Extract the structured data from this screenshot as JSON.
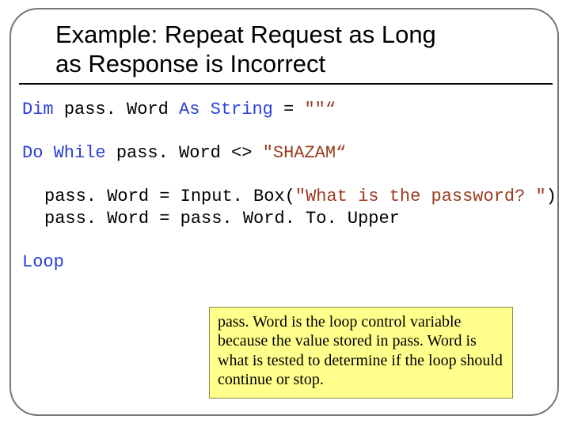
{
  "title_line1": "Example: Repeat Request as Long",
  "title_line2": "as Response is Incorrect",
  "code": {
    "kw_dim": "Dim",
    "var": "pass. Word",
    "kw_asstring": "As String",
    "eq": " = ",
    "empty": "\"\"“",
    "kw_dowhile": "Do While",
    "neq": " <> ",
    "shazam": "\"SHAZAM“",
    "assign1_lhs": "pass. Word = ",
    "assign1_rhs_a": "Input. Box(",
    "assign1_rhs_str": "\"What is the password? \"",
    "assign1_rhs_b": ")",
    "assign2": "pass. Word = pass. Word. To. Upper",
    "kw_loop": "Loop"
  },
  "callout": "pass. Word is the loop control variable because the value stored in pass. Word is what is tested to determine if the loop should continue or stop.",
  "slide_number": ""
}
